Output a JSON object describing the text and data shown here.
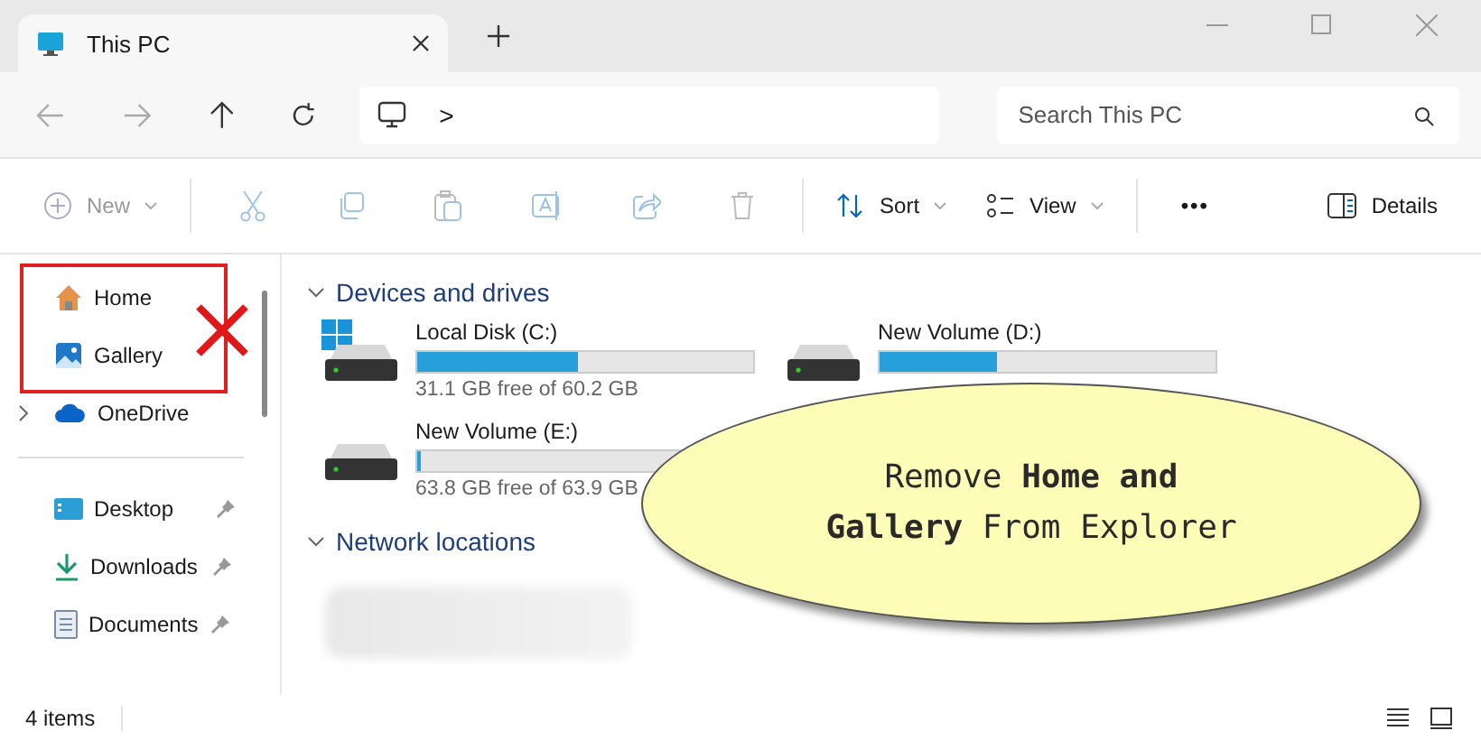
{
  "window": {
    "tab_title": "This PC"
  },
  "address": {
    "chevron": ">"
  },
  "search": {
    "placeholder": "Search This PC"
  },
  "toolbar": {
    "new": "New",
    "sort": "Sort",
    "view": "View",
    "more": "•••",
    "details": "Details"
  },
  "sidebar": {
    "items": [
      {
        "label": "Home",
        "kind": "home",
        "expandable": false,
        "pinned": false
      },
      {
        "label": "Gallery",
        "kind": "gallery",
        "expandable": false,
        "pinned": false
      },
      {
        "label": "OneDrive",
        "kind": "cloud",
        "expandable": true,
        "pinned": false
      },
      {
        "label": "Desktop",
        "kind": "desktop",
        "expandable": false,
        "pinned": true
      },
      {
        "label": "Downloads",
        "kind": "download",
        "expandable": false,
        "pinned": true
      },
      {
        "label": "Documents",
        "kind": "document",
        "expandable": false,
        "pinned": true
      }
    ]
  },
  "sections": [
    {
      "title": "Devices and drives",
      "expanded": true,
      "drives": [
        {
          "name": "Local Disk (C:)",
          "level": 0.48,
          "free": "31.1 GB free of 60.2 GB",
          "system": true
        },
        {
          "name": "New Volume (D:)",
          "level": 0.35,
          "system": false
        },
        {
          "name": "New Volume (E:)",
          "level": 0.01,
          "free": "63.8 GB free of 63.9 GB",
          "system": false
        }
      ]
    },
    {
      "title": "Network locations",
      "expanded": true
    }
  ],
  "status_bar": {
    "count": "4 items"
  },
  "callout": {
    "text": "Remove **Home and** **Gallery** From Explorer"
  }
}
